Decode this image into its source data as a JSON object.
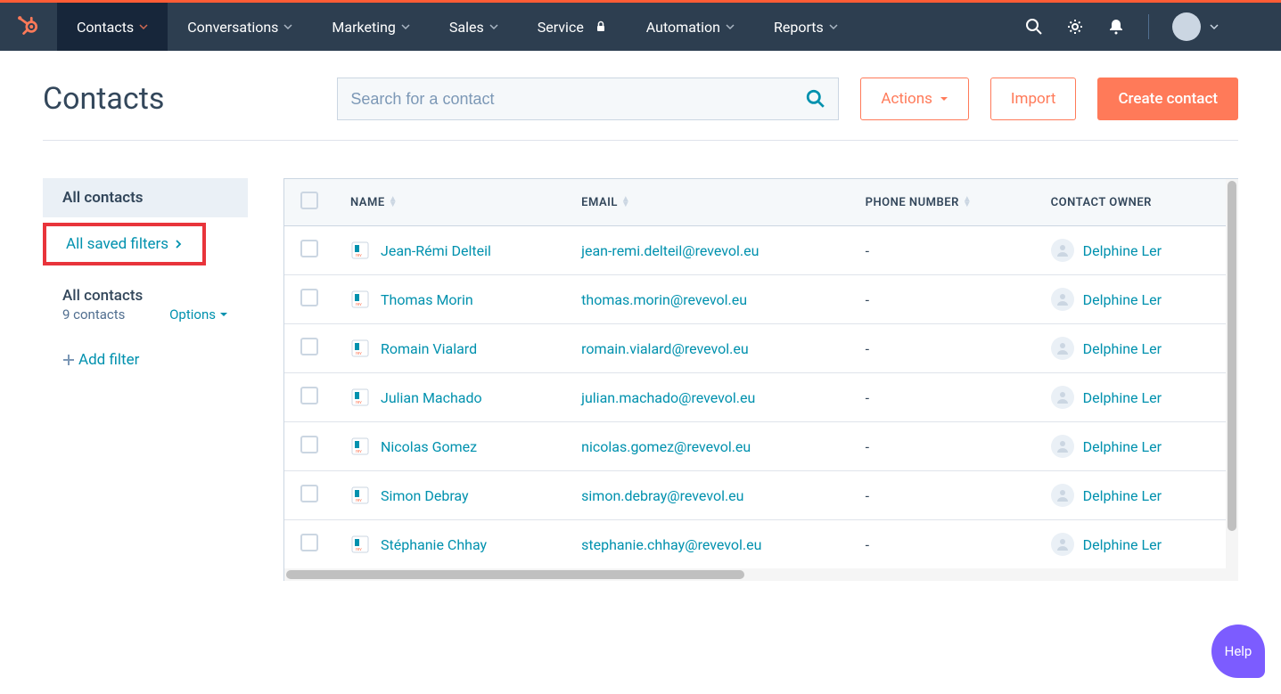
{
  "nav": {
    "items": [
      {
        "label": "Contacts"
      },
      {
        "label": "Conversations"
      },
      {
        "label": "Marketing"
      },
      {
        "label": "Sales"
      },
      {
        "label": "Service"
      },
      {
        "label": "Automation"
      },
      {
        "label": "Reports"
      }
    ]
  },
  "header": {
    "title": "Contacts",
    "search_placeholder": "Search for a contact",
    "actions_label": "Actions",
    "import_label": "Import",
    "create_label": "Create contact"
  },
  "sidebar": {
    "all_contacts": "All contacts",
    "saved_filters": "All saved filters",
    "sub_title": "All contacts",
    "sub_count": "9 contacts",
    "options": "Options",
    "add_filter": "Add filter"
  },
  "table": {
    "columns": {
      "name": "NAME",
      "email": "EMAIL",
      "phone": "PHONE NUMBER",
      "owner": "CONTACT OWNER"
    },
    "rows": [
      {
        "name": "Jean-Rémi Delteil",
        "email": "jean-remi.delteil@revevol.eu",
        "phone": "-",
        "owner": "Delphine Ler"
      },
      {
        "name": "Thomas Morin",
        "email": "thomas.morin@revevol.eu",
        "phone": "-",
        "owner": "Delphine Ler"
      },
      {
        "name": "Romain Vialard",
        "email": "romain.vialard@revevol.eu",
        "phone": "-",
        "owner": "Delphine Ler"
      },
      {
        "name": "Julian Machado",
        "email": "julian.machado@revevol.eu",
        "phone": "-",
        "owner": "Delphine Ler"
      },
      {
        "name": "Nicolas Gomez",
        "email": "nicolas.gomez@revevol.eu",
        "phone": "-",
        "owner": "Delphine Ler"
      },
      {
        "name": "Simon Debray",
        "email": "simon.debray@revevol.eu",
        "phone": "-",
        "owner": "Delphine Ler"
      },
      {
        "name": "Stéphanie Chhay",
        "email": "stephanie.chhay@revevol.eu",
        "phone": "-",
        "owner": "Delphine Ler"
      }
    ]
  },
  "help": {
    "label": "Help"
  }
}
